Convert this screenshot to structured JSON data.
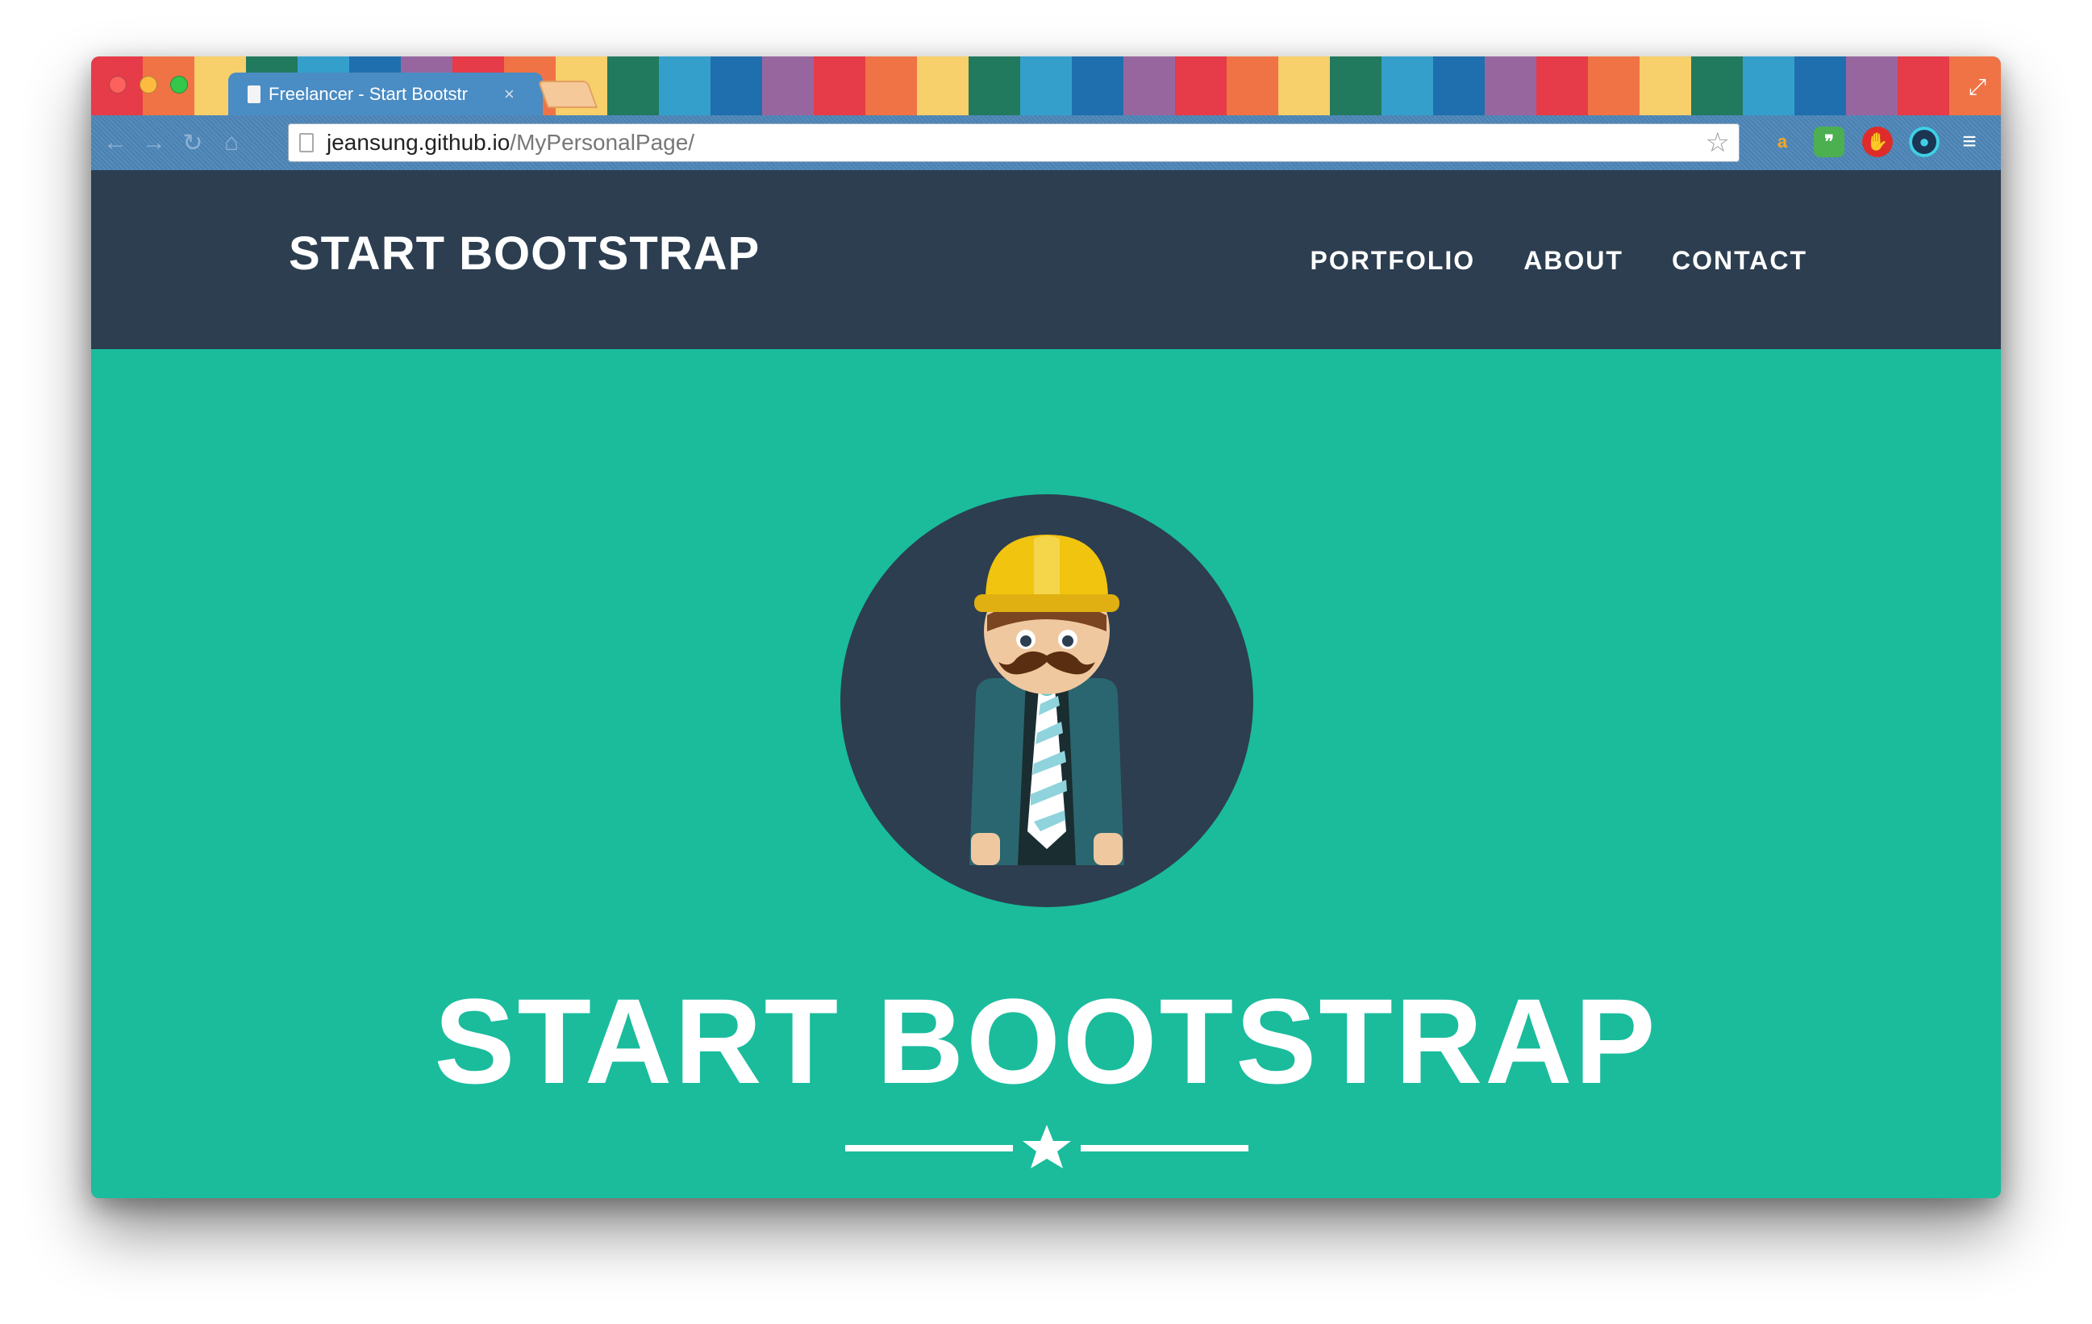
{
  "browser": {
    "tab_title": "Freelancer - Start Bootstr",
    "tab_close": "×",
    "url_host": "jeansung.github.io",
    "url_path": "/MyPersonalPage/",
    "theme_stripes": [
      "#e63b49",
      "#f07346",
      "#f7cf6b",
      "#217a5d",
      "#359fcc",
      "#1f6fae",
      "#98669f",
      "#e63b49",
      "#f07346",
      "#f7cf6b",
      "#217a5d",
      "#359fcc",
      "#1f6fae",
      "#98669f",
      "#e63b49",
      "#f07346",
      "#f7cf6b",
      "#217a5d",
      "#359fcc",
      "#1f6fae",
      "#98669f",
      "#e63b49",
      "#f07346",
      "#f7cf6b",
      "#217a5d",
      "#359fcc",
      "#1f6fae",
      "#98669f",
      "#e63b49",
      "#f07346",
      "#f7cf6b",
      "#217a5d",
      "#359fcc",
      "#1f6fae",
      "#98669f",
      "#e63b49",
      "#f07346",
      "#f7cf6b"
    ],
    "extensions": [
      "amazon-icon",
      "quote-icon",
      "stop-hand-icon",
      "eye-icon",
      "menu-icon"
    ]
  },
  "site": {
    "brand": "START BOOTSTRAP",
    "nav": [
      "PORTFOLIO",
      "ABOUT",
      "CONTACT"
    ],
    "headline": "START BOOTSTRAP"
  },
  "colors": {
    "navbar": "#2c3e50",
    "hero": "#1abc9c",
    "text": "#ffffff"
  }
}
